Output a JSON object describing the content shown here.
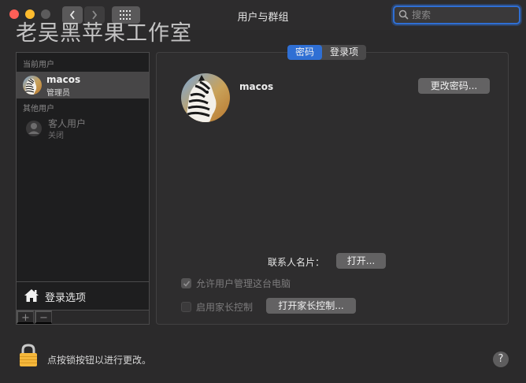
{
  "window": {
    "title": "用户与群组",
    "search_placeholder": "搜索",
    "watermark": "老吴黑苹果工作室"
  },
  "sidebar": {
    "current_users_label": "当前用户",
    "current_user": {
      "name": "macos",
      "role": "管理员"
    },
    "other_users_label": "其他用户",
    "guest_user": {
      "name": "客人用户",
      "status": "关闭"
    },
    "login_options_label": "登录选项",
    "add_label": "+",
    "remove_label": "−"
  },
  "main": {
    "tabs": [
      {
        "label": "密码",
        "active": true
      },
      {
        "label": "登录项",
        "active": false
      }
    ],
    "account_name": "macos",
    "change_password_label": "更改密码...",
    "contact_card_label": "联系人名片：",
    "open_label": "打开...",
    "allow_admin_label": "允许用户管理这台电脑",
    "allow_admin_checked": true,
    "parental_controls_label": "启用家长控制",
    "parental_controls_checked": false,
    "open_parental_label": "打开家长控制..."
  },
  "footer": {
    "lock_text": "点按锁按钮以进行更改。",
    "help_label": "?"
  },
  "colors": {
    "accent": "#2f6fd4",
    "close": "#fe5f57",
    "minimize": "#febc2e",
    "lock": "#f5b73b"
  }
}
